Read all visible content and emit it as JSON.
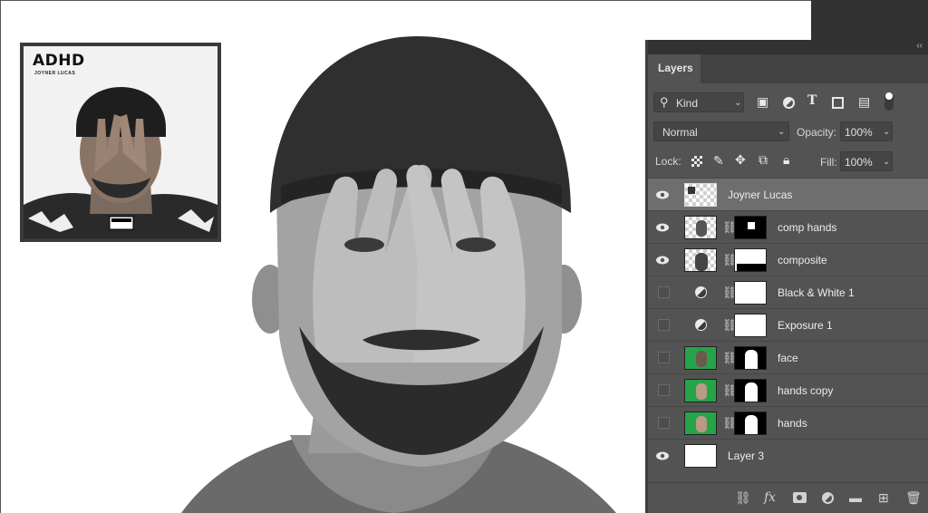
{
  "reference": {
    "title": "ADHD",
    "subtitle": "JOYNER LUCAS"
  },
  "panel": {
    "tab": "Layers",
    "filter": {
      "label": "Kind"
    },
    "blend_mode": "Normal",
    "opacity_label": "Opacity:",
    "opacity_value": "100%",
    "lock_label": "Lock:",
    "fill_label": "Fill:",
    "fill_value": "100%",
    "layers": [
      {
        "name": "Joyner Lucas",
        "visible": true,
        "selected": true
      },
      {
        "name": "comp hands",
        "visible": true
      },
      {
        "name": "composite",
        "visible": true
      },
      {
        "name": "Black & White 1",
        "visible": false
      },
      {
        "name": "Exposure 1",
        "visible": false
      },
      {
        "name": "face",
        "visible": false
      },
      {
        "name": "hands copy",
        "visible": false
      },
      {
        "name": "hands",
        "visible": false
      },
      {
        "name": "Layer 3",
        "visible": true
      }
    ]
  },
  "colors": {
    "panel_bg": "#535353",
    "selected_row": "#6e6e6e",
    "mask_green": "#27a34a"
  }
}
